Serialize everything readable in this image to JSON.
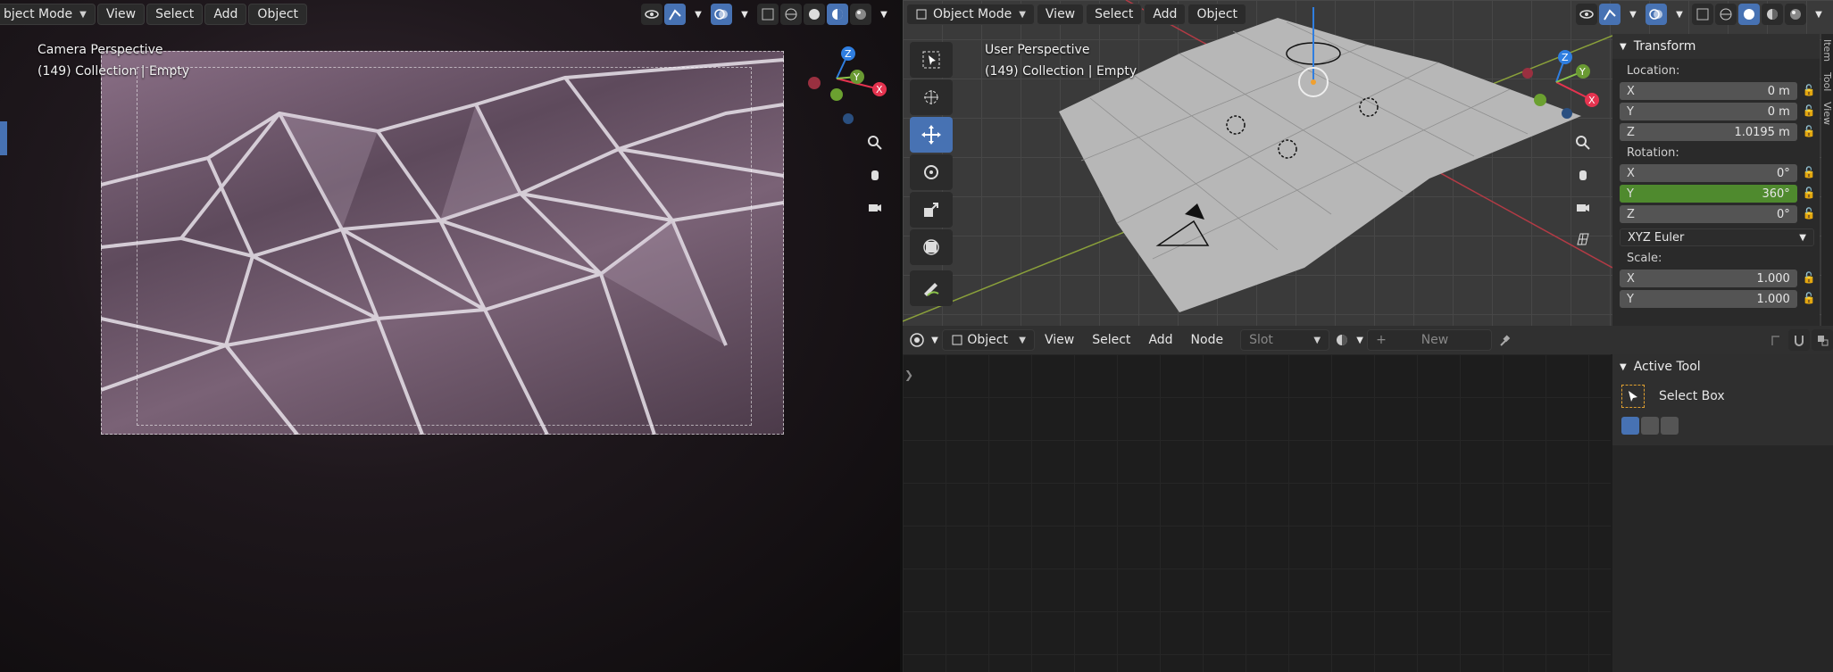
{
  "left_view": {
    "mode_label": "bject Mode",
    "menus": [
      "View",
      "Select",
      "Add",
      "Object"
    ],
    "overlay_title": "Camera Perspective",
    "overlay_subtitle": "(149) Collection | Empty"
  },
  "right_view": {
    "mode_label": "Object Mode",
    "menus": [
      "View",
      "Select",
      "Add",
      "Object"
    ],
    "overlay_title": "User Perspective",
    "overlay_subtitle": "(149) Collection | Empty"
  },
  "gizmo": {
    "x": "X",
    "y": "Y",
    "z": "Z"
  },
  "transform_panel": {
    "title": "Transform",
    "location_label": "Location:",
    "location": [
      {
        "axis": "X",
        "value": "0 m"
      },
      {
        "axis": "Y",
        "value": "0 m"
      },
      {
        "axis": "Z",
        "value": "1.0195 m"
      }
    ],
    "rotation_label": "Rotation:",
    "rotation": [
      {
        "axis": "X",
        "value": "0°"
      },
      {
        "axis": "Y",
        "value": "360°"
      },
      {
        "axis": "Z",
        "value": "0°"
      }
    ],
    "rotation_mode": "XYZ Euler",
    "scale_label": "Scale:",
    "scale": [
      {
        "axis": "X",
        "value": "1.000"
      },
      {
        "axis": "Y",
        "value": "1.000"
      }
    ]
  },
  "sidebar_tabs": [
    "Item",
    "Tool",
    "View"
  ],
  "node_editor": {
    "mode_label": "Object",
    "menus": [
      "View",
      "Select",
      "Add",
      "Node"
    ],
    "slot_label": "Slot",
    "new_label": "New"
  },
  "active_tool": {
    "title": "Active Tool",
    "tool_name": "Select Box"
  },
  "colors": {
    "accent": "#4772b3",
    "x_axis": "#e5334f",
    "y_axis": "#8bc34a",
    "z_axis": "#2f7ee0",
    "active_field": "#4f8a2e"
  }
}
